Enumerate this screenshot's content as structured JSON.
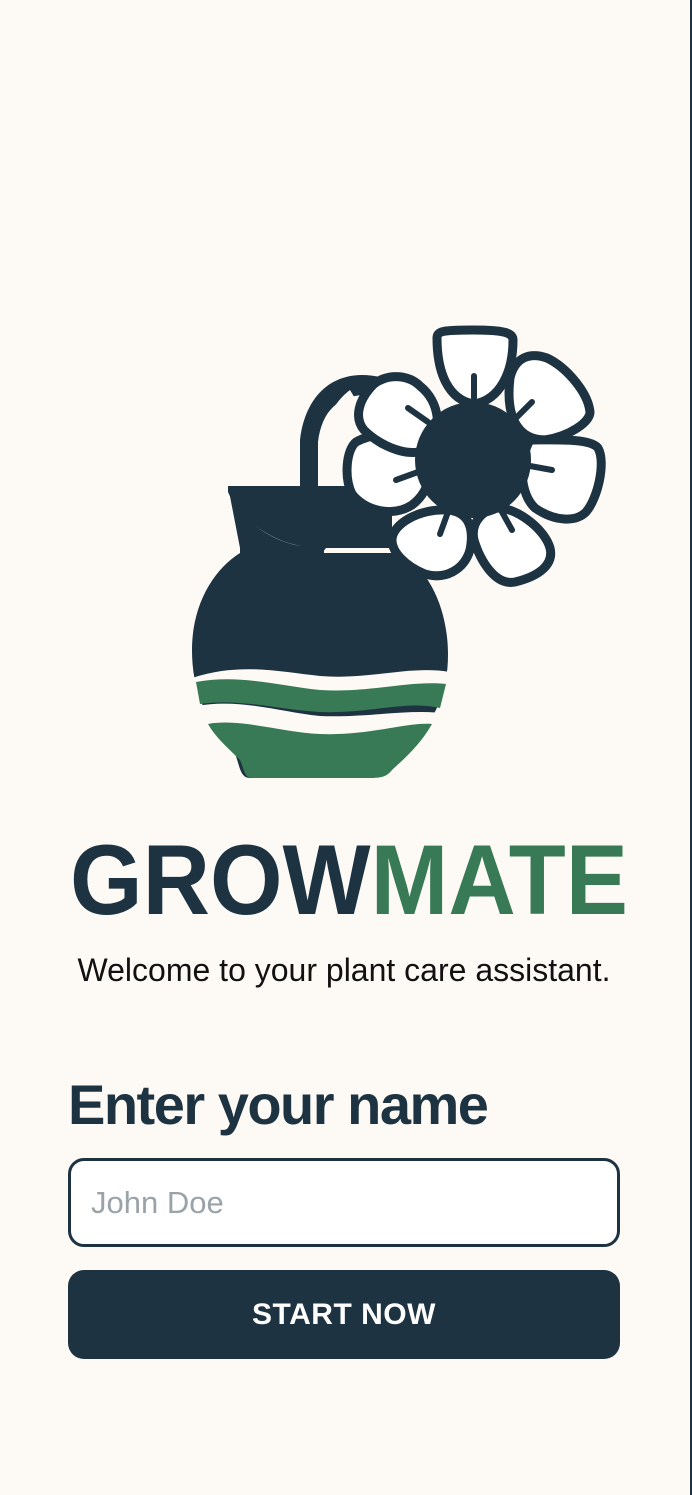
{
  "app": {
    "name_part_1": "GROW",
    "name_part_2": "MATE",
    "tagline": "Welcome to your plant care assistant."
  },
  "form": {
    "heading": "Enter your name",
    "name_placeholder": "John Doe",
    "name_value": "",
    "submit_label": "START NOW"
  },
  "icons": {
    "logo": "plant-pot-flower-icon"
  },
  "colors": {
    "background": "#fdf9f5",
    "navy": "#1d3341",
    "green": "#377a55",
    "input_background": "#ffffff",
    "placeholder": "#9aa3a8"
  }
}
